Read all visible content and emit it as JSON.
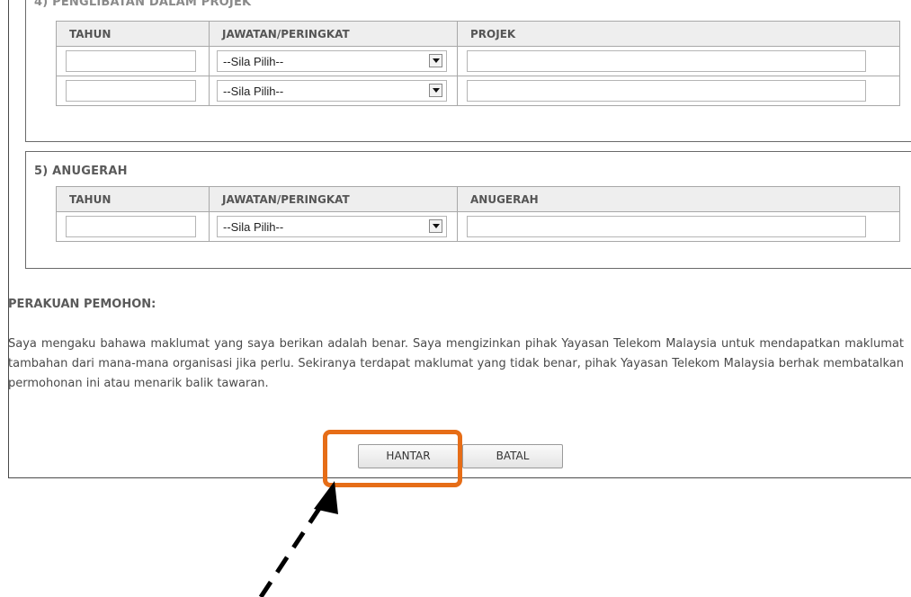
{
  "section4": {
    "title": "4) PENGLIBATAN DALAM PROJEK",
    "headers": [
      "TAHUN",
      "JAWATAN/PERINGKAT",
      "PROJEK"
    ],
    "rows": [
      {
        "tahun": "",
        "jawatan": "--Sila Pilih--",
        "projek": ""
      },
      {
        "tahun": "",
        "jawatan": "--Sila Pilih--",
        "projek": ""
      }
    ]
  },
  "section5": {
    "title": "5) ANUGERAH",
    "headers": [
      "TAHUN",
      "JAWATAN/PERINGKAT",
      "ANUGERAH"
    ],
    "rows": [
      {
        "tahun": "",
        "jawatan": "--Sila Pilih--",
        "anugerah": ""
      }
    ]
  },
  "declaration": {
    "heading": "PERAKUAN PEMOHON:",
    "text": "Saya mengaku bahawa maklumat yang saya berikan adalah benar. Saya mengizinkan pihak Yayasan Telekom Malaysia untuk mendapatkan maklumat tambahan dari mana-mana organisasi jika perlu. Sekiranya terdapat maklumat yang tidak benar, pihak Yayasan Telekom Malaysia berhak membatalkan permohonan ini atau menarik balik tawaran."
  },
  "buttons": {
    "submit_label": "HANTAR",
    "cancel_label": "BATAL"
  },
  "colors": {
    "highlight": "#e66d17",
    "arrow": "#000000"
  },
  "icons": {
    "dropdown": "chevron-down-icon",
    "pointer": "dashed-arrow-icon"
  }
}
